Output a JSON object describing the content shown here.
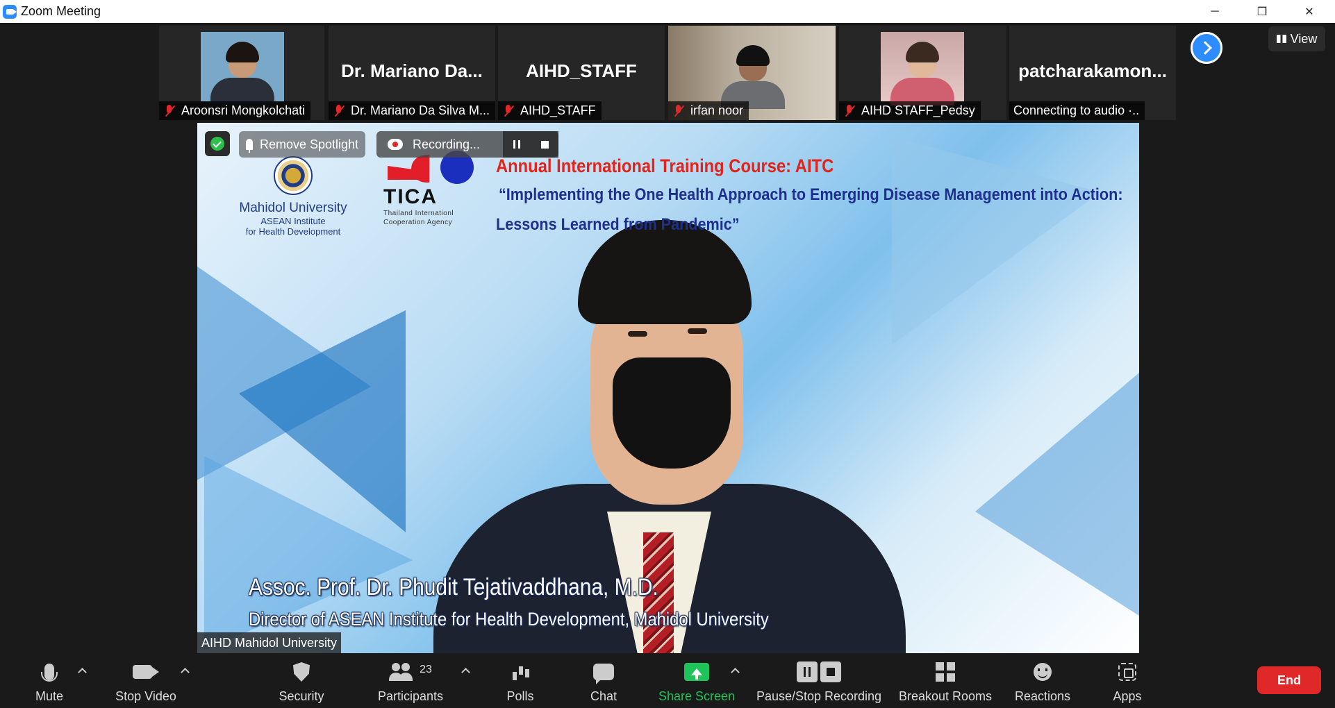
{
  "window": {
    "title": "Zoom Meeting",
    "controls": {
      "minimize": "─",
      "restore": "❐",
      "close": "✕"
    }
  },
  "gallery": {
    "tiles": [
      {
        "display": "photo",
        "name": "Aroonsri Mongkolchati",
        "muted": true
      },
      {
        "display": "name",
        "big_name": "Dr. Mariano  Da...",
        "name": "Dr. Mariano Da Silva M...",
        "muted": true
      },
      {
        "display": "name",
        "big_name": "AIHD_STAFF",
        "name": "AIHD_STAFF",
        "muted": true
      },
      {
        "display": "photo",
        "name": "irfan noor",
        "muted": true
      },
      {
        "display": "photo",
        "name": "AIHD STAFF_Pedsy",
        "muted": true
      },
      {
        "display": "name",
        "big_name": "patcharakamon...",
        "name": "Connecting to audio ·..",
        "muted": false
      }
    ],
    "next_page_icon": "chevron-right-icon",
    "view_label": "View"
  },
  "main_video": {
    "overlay": {
      "security_badge_icon": "shield-check-icon",
      "remove_spotlight_label": "Remove Spotlight",
      "recording_label": "Recording...",
      "pause_icon": "pause-icon",
      "stop_icon": "stop-icon"
    },
    "slide": {
      "mahidol_name": "Mahidol University",
      "mahidol_sub1": "ASEAN Institute",
      "mahidol_sub2": "for Health Development",
      "tica_name": "TICA",
      "tica_sub1": "Thailand Internationl",
      "tica_sub2": "Cooperation Agency",
      "course_title": "Annual International Training Course: AITC",
      "course_line1": "“Implementing the One Health Approach to Emerging Disease Management into Action:",
      "course_line2": "Lessons Learned from               Pandemic”",
      "speaker_name": "Assoc. Prof. Dr. Phudit Tejativaddhana, M.D.",
      "speaker_title": "Director of ASEAN Institute for Health Development, Mahidol University"
    },
    "participant_name": "AIHD Mahidol University",
    "colors": {
      "course_title": "#e2231a",
      "course_sub": "#1e2f8c"
    }
  },
  "toolbar": {
    "mute": "Mute",
    "stop_video": "Stop Video",
    "security": "Security",
    "participants": "Participants",
    "participants_count": "23",
    "polls": "Polls",
    "chat": "Chat",
    "share_screen": "Share Screen",
    "pause_stop_recording": "Pause/Stop Recording",
    "breakout_rooms": "Breakout Rooms",
    "reactions": "Reactions",
    "apps": "Apps",
    "end": "End",
    "colors": {
      "share": "#1ec45a",
      "end": "#e02828"
    }
  }
}
